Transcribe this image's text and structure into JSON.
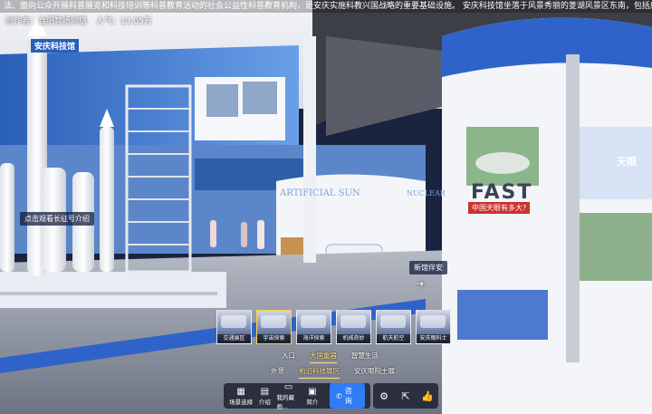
{
  "marquee": "法、面向公众开展科普展览和科技培训等科普教育活动的社会公益性科普教育机构，是安庆实施科教兴国战略的重要基础设施。 安庆科技馆坐落于风景秀丽的菱湖风景区东南，包括序厅、前沿科技展厅、多功能厅、临时展厅、天象馆等五大功能区。常设展厅面积",
  "meta": {
    "creator_label": "创作者：",
    "creator": "合肥智扬网络",
    "popularity_label": "人气：",
    "popularity": "13.05万"
  },
  "hotspots": {
    "left": "点击观看长征号介绍",
    "right": "新馆伴安"
  },
  "exhibit_text": {
    "top_sign": "安庆科技馆",
    "sun": "ARTIFICIAL SUN",
    "nuclear": "NUCLEAR",
    "fast": "FAST",
    "fast_banner": "中国天眼有多大?",
    "tianyan": "天眼"
  },
  "thumbnails": [
    {
      "label": "交通展区",
      "active": false
    },
    {
      "label": "宇宙探索",
      "active": true
    },
    {
      "label": "海洋探索",
      "active": false
    },
    {
      "label": "机械奇妙",
      "active": false
    },
    {
      "label": "航天航空",
      "active": false
    },
    {
      "label": "安庆眼科士",
      "active": false
    }
  ],
  "group_tabs_row1": [
    {
      "label": "入口",
      "active": false
    },
    {
      "label": "大国重器",
      "active": true
    },
    {
      "label": "智慧生活",
      "active": false
    }
  ],
  "group_tabs_row2": [
    {
      "label": "外景",
      "active": false
    },
    {
      "label": "前沿科技展区",
      "active": true
    },
    {
      "label": "安庆眼院士展",
      "active": false
    }
  ],
  "toolbar": {
    "scene_select": "场景选择",
    "intro": "介绍",
    "works": "我的藏画...",
    "brief": "简介",
    "consult": "咨询"
  },
  "colors": {
    "accent": "#2f7cf6",
    "active_tab": "#ffe08a"
  }
}
